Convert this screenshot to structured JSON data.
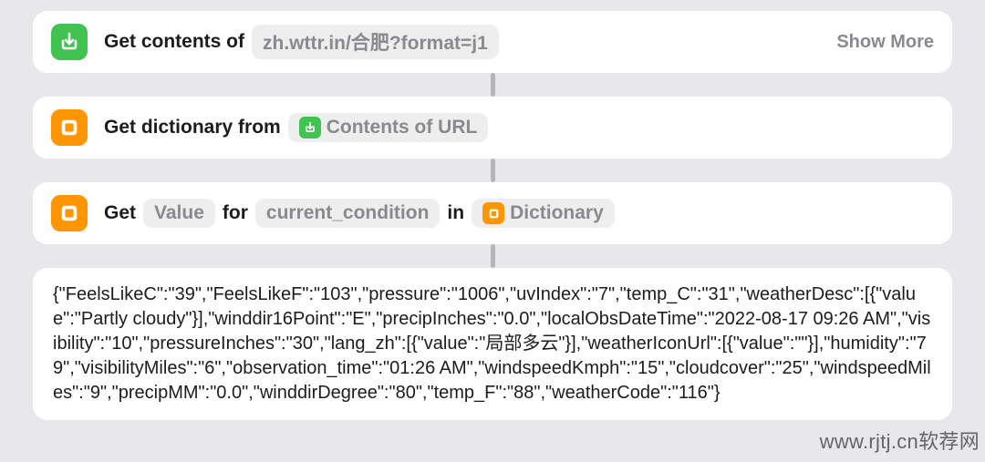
{
  "actions": {
    "getContents": {
      "prefix": "Get contents of",
      "urlPill": "zh.wttr.in/合肥?format=j1",
      "showMore": "Show More"
    },
    "getDictionary": {
      "prefix": "Get dictionary from",
      "sourcePill": "Contents of URL"
    },
    "getValue": {
      "p1": "Get",
      "valPill": "Value",
      "p2": "for",
      "keyPill": "current_condition",
      "p3": "in",
      "dictPill": "Dictionary"
    }
  },
  "output": "{\"FeelsLikeC\":\"39\",\"FeelsLikeF\":\"103\",\"pressure\":\"1006\",\"uvIndex\":\"7\",\"temp_C\":\"31\",\"weatherDesc\":[{\"value\":\"Partly cloudy\"}],\"winddir16Point\":\"E\",\"precipInches\":\"0.0\",\"localObsDateTime\":\"2022-08-17 09:26 AM\",\"visibility\":\"10\",\"pressureInches\":\"30\",\"lang_zh\":[{\"value\":\"局部多云\"}],\"weatherIconUrl\":[{\"value\":\"\"}],\"humidity\":\"79\",\"visibilityMiles\":\"6\",\"observation_time\":\"01:26 AM\",\"windspeedKmph\":\"15\",\"cloudcover\":\"25\",\"windspeedMiles\":\"9\",\"precipMM\":\"0.0\",\"winddirDegree\":\"80\",\"temp_F\":\"88\",\"weatherCode\":\"116\"}",
  "watermark": "www.rjtj.cn软荐网"
}
